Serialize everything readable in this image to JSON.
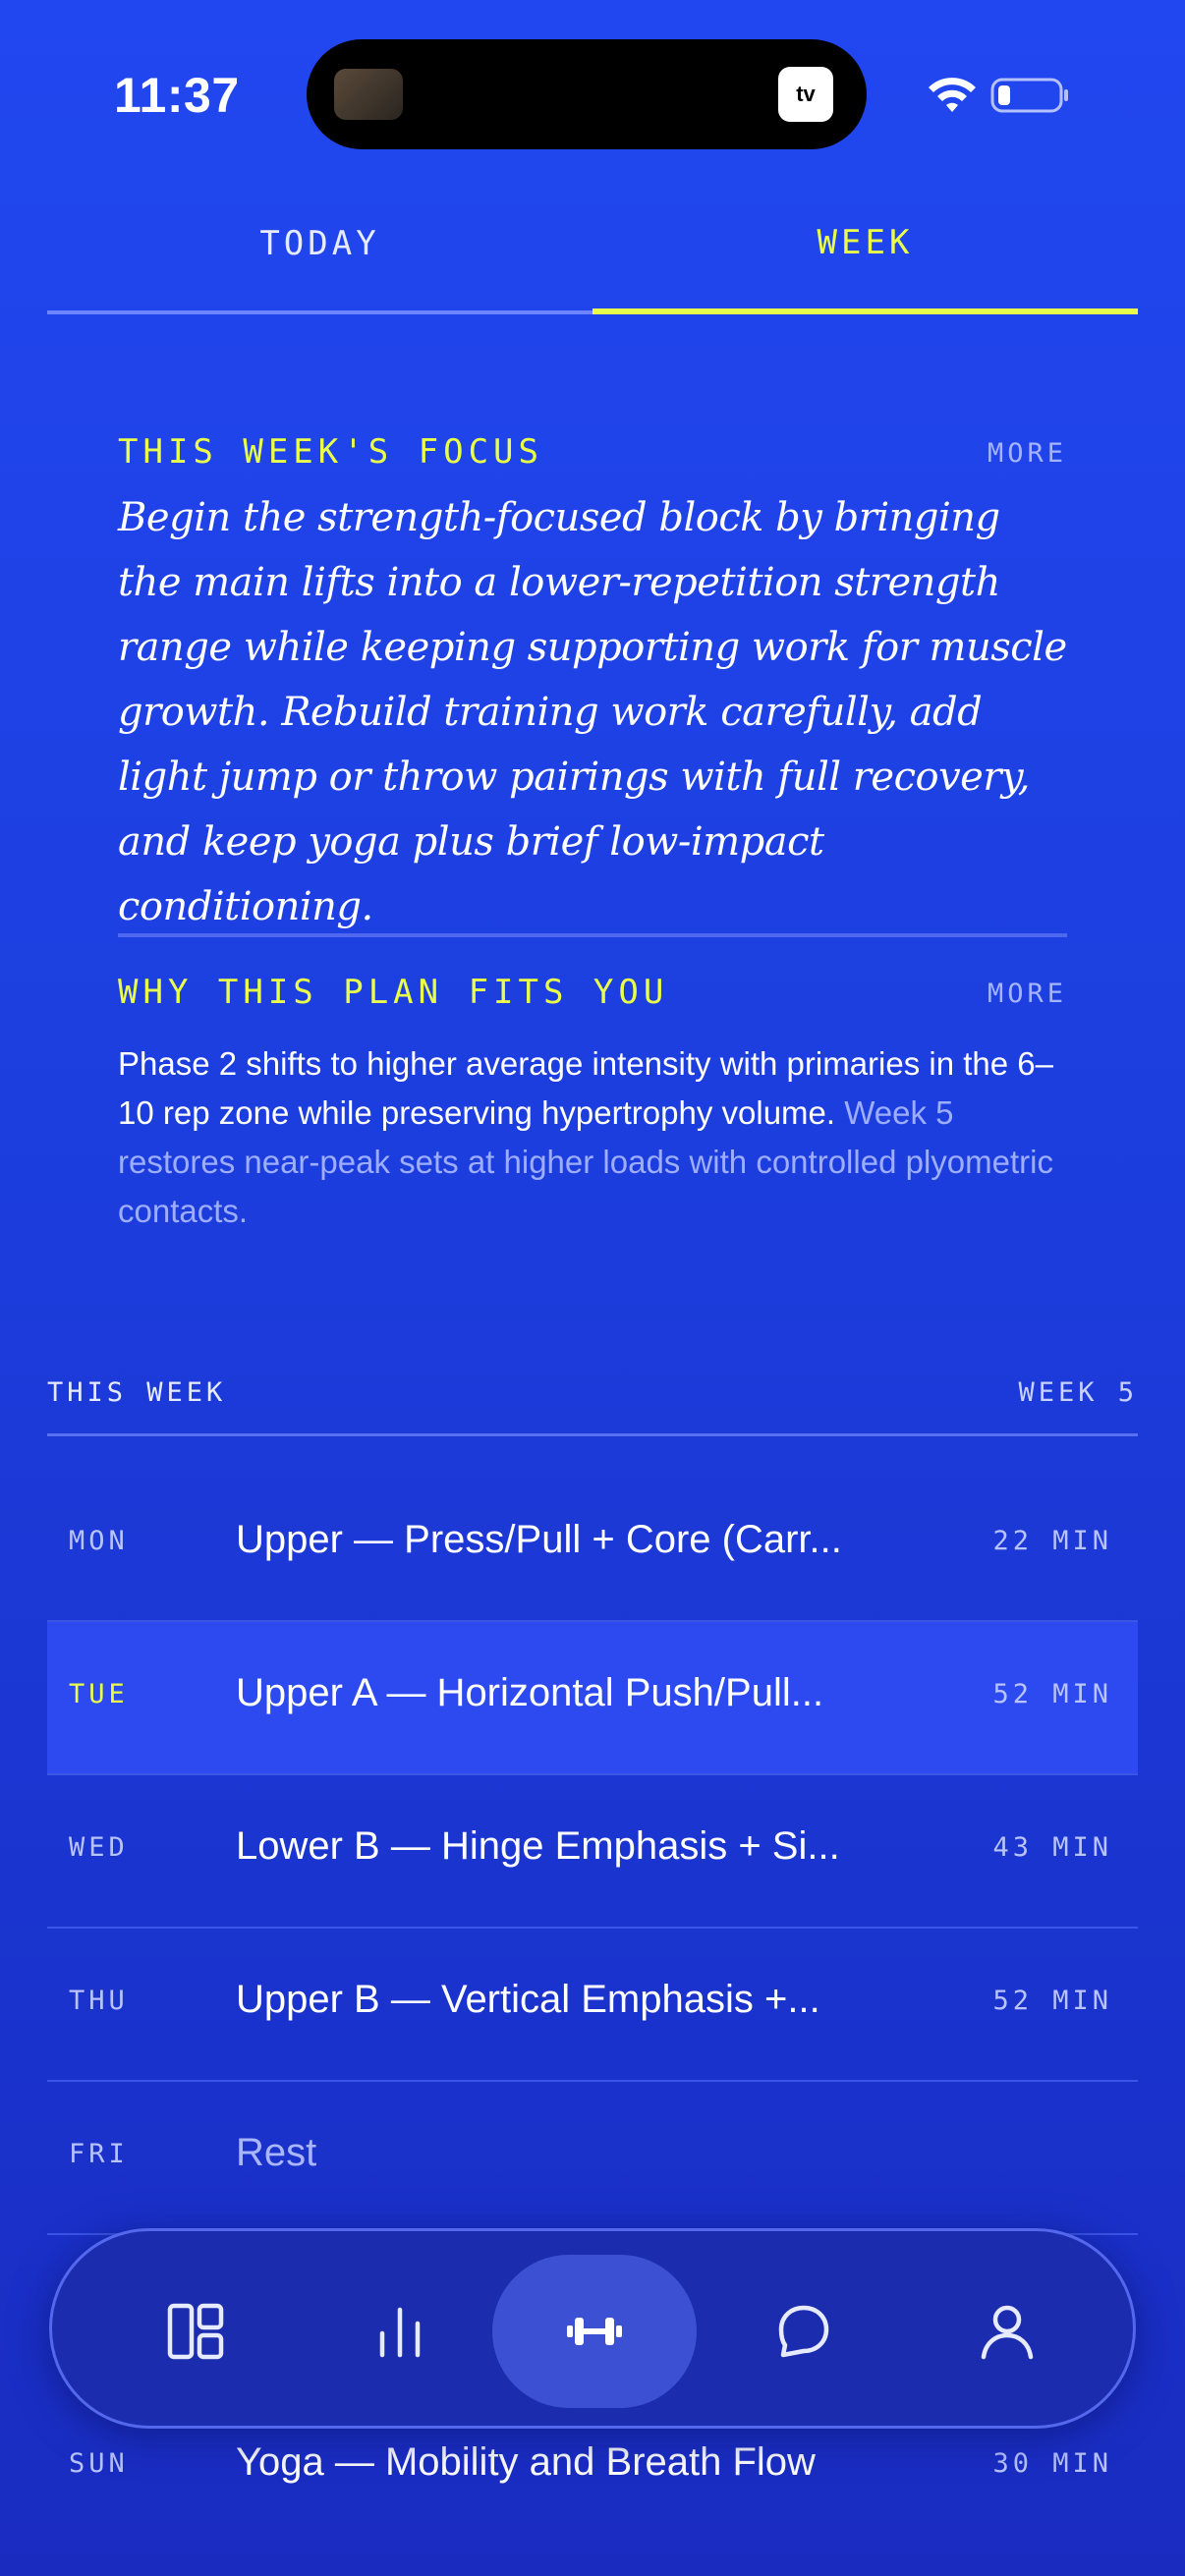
{
  "status_bar": {
    "time": "11:37",
    "tv_label": "tv"
  },
  "tabs": [
    {
      "label": "TODAY",
      "active": false
    },
    {
      "label": "WEEK",
      "active": true
    }
  ],
  "focus": {
    "title": "THIS WEEK'S FOCUS",
    "more": "MORE",
    "body": "Begin the strength-focused block by bringing the main lifts into a lower-repetition strength range while keeping supporting work for muscle growth. Rebuild training work carefully, add light jump or throw pairings with full recovery, and keep yoga plus brief low-impact conditioning."
  },
  "why": {
    "title": "WHY THIS PLAN FITS YOU",
    "more": "MORE",
    "body_primary": "Phase 2 shifts to higher average intensity with primaries in the 6–10 rep zone while preserving hypertrophy volume.",
    "body_secondary": "Week 5 restores near-peak sets at higher loads with controlled plyometric contacts."
  },
  "week": {
    "label": "THIS WEEK",
    "week_number": "WEEK 5",
    "days": [
      {
        "day": "MON",
        "title": "Upper — Press/Pull + Core (Carr...",
        "duration": "22 MIN",
        "active": false
      },
      {
        "day": "TUE",
        "title": "Upper A — Horizontal Push/Pull...",
        "duration": "52 MIN",
        "active": true
      },
      {
        "day": "WED",
        "title": "Lower B — Hinge Emphasis + Si...",
        "duration": "43 MIN",
        "active": false
      },
      {
        "day": "THU",
        "title": "Upper B — Vertical Emphasis +...",
        "duration": "52 MIN",
        "active": false
      },
      {
        "day": "FRI",
        "title": "Rest",
        "duration": "",
        "active": false
      },
      {
        "day": "SUN",
        "title": "Yoga — Mobility and Breath Flow",
        "duration": "30 MIN",
        "active": false
      }
    ]
  },
  "nav": [
    {
      "icon": "dashboard-icon",
      "active": false
    },
    {
      "icon": "stats-icon",
      "active": false
    },
    {
      "icon": "dumbbell-icon",
      "active": true
    },
    {
      "icon": "chat-icon",
      "active": false
    },
    {
      "icon": "profile-icon",
      "active": false
    }
  ],
  "colors": {
    "background": "#1d3be0",
    "accent": "#eaff4a"
  }
}
